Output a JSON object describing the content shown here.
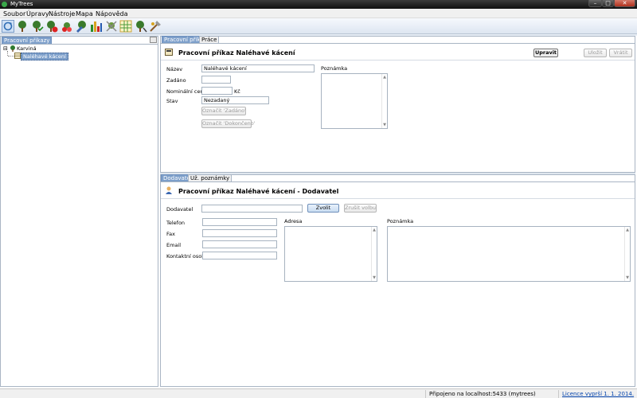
{
  "window": {
    "title": "MyTrees",
    "minimize": "–",
    "maximize": "□",
    "close": "✕"
  },
  "menu": [
    "Soubor",
    "Úpravy",
    "Nástroje",
    "Mapa",
    "Nápověda"
  ],
  "toolbar": {
    "icons": [
      "refresh-icon",
      "tree-icon",
      "tree-check-icon",
      "tree-delete-icon",
      "tree-remove-icon",
      "tree-edit-icon",
      "bar-chart-icon",
      "tree-tools-icon",
      "grid-icon",
      "tree-plant-icon",
      "tree-axe-icon"
    ]
  },
  "left_panel": {
    "tab": "Pracovní příkazy",
    "tree": {
      "root": "Karviná",
      "expander": "⊟",
      "child": "Naléhavé kácení"
    }
  },
  "top_panel": {
    "tabs": [
      "Pracovní příkaz",
      "Práce"
    ],
    "header": "Pracovní příkaz  Naléhavé kácení",
    "buttons": {
      "edit": "Upravit",
      "save": "Uložit",
      "revert": "Vrátit"
    },
    "fields": {
      "name_label": "Název",
      "name_value": "Naléhavé kácení",
      "assigned_label": "Zadáno",
      "assigned_value": "",
      "price_label": "Nominální cena",
      "price_value": "",
      "currency": "Kč",
      "state_label": "Stav",
      "state_value": "Nezadaný"
    },
    "state_buttons": {
      "mark_assigned": "Označit 'Zadáno'",
      "mark_done": "Označit 'Dokončeno'"
    },
    "note_label": "Poznámka"
  },
  "bottom_panel": {
    "tabs": [
      "Dodavatel",
      "Už. poznámky"
    ],
    "header": "Pracovní příkaz  Naléhavé kácení  -  Dodavatel",
    "supplier_label": "Dodavatel",
    "supplier_value": "",
    "choose_button": "Zvolit",
    "cancel_button": "Zrušit volbu",
    "fields": {
      "phone": "Telefon",
      "fax": "Fax",
      "email": "Email",
      "contact": "Kontaktní osoba"
    },
    "address_label": "Adresa",
    "note_label": "Poznámka"
  },
  "status": {
    "connection": "Připojeno na localhost:5433 (mytrees)",
    "license": "Licence vyprší 1. 1. 2014."
  }
}
